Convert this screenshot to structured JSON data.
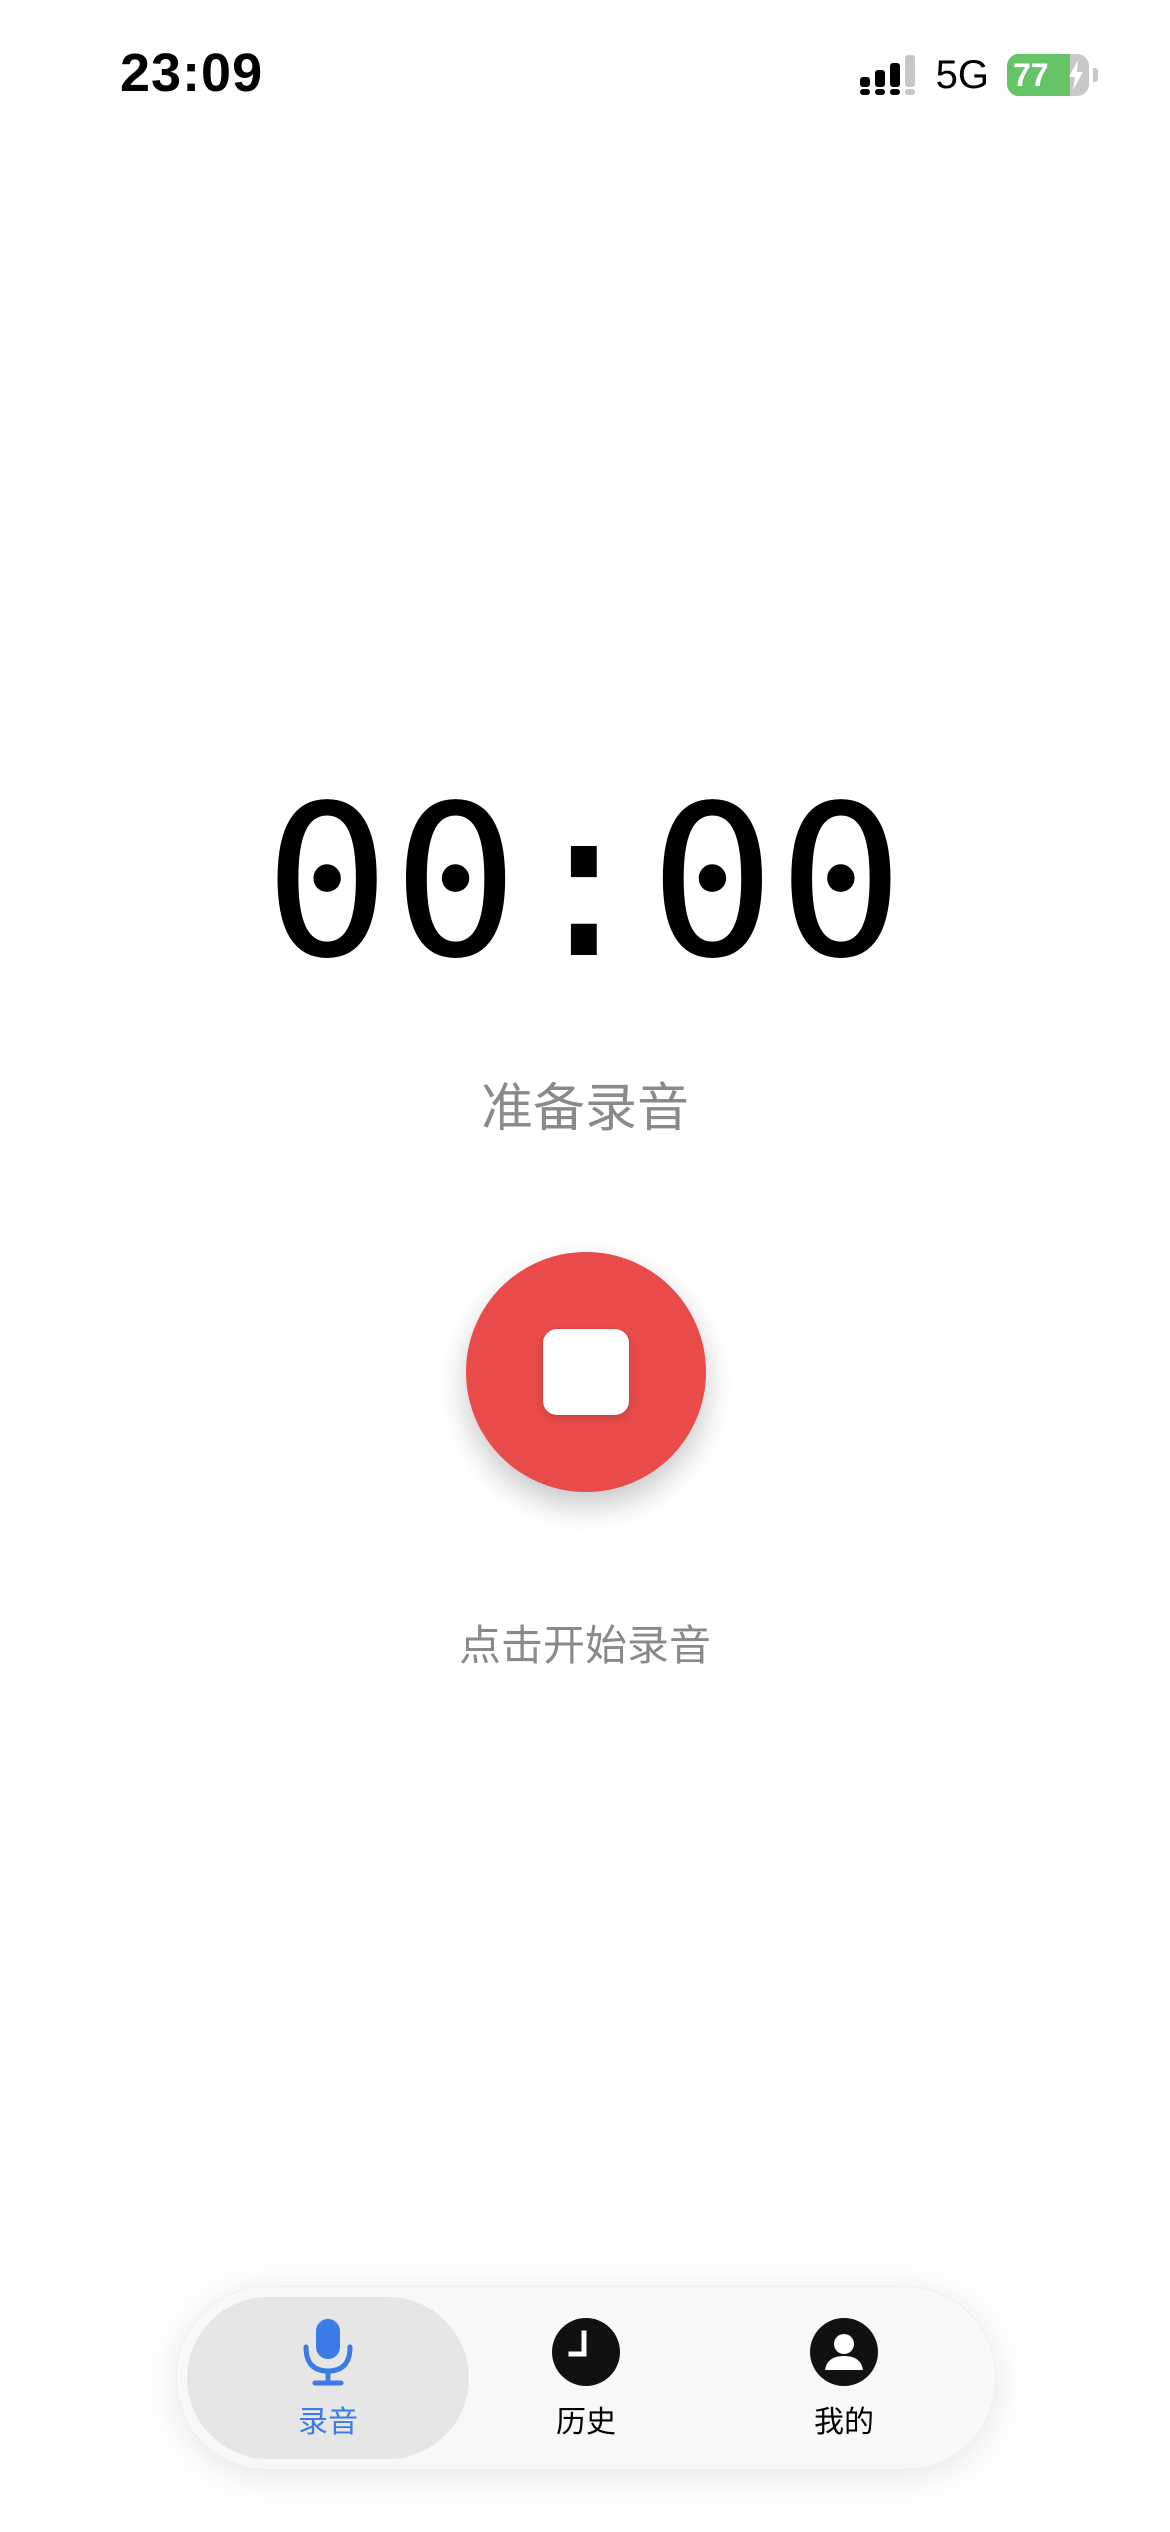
{
  "status_bar": {
    "time": "23:09",
    "network": "5G",
    "battery": "77",
    "battery_level": 0.77,
    "charging": true
  },
  "recorder": {
    "timer": "00:00",
    "status": "准备录音",
    "hint": "点击开始录音",
    "button_icon": "stop-icon"
  },
  "tab_bar": {
    "tabs": [
      {
        "label": "录音",
        "icon": "microphone-icon",
        "active": true
      },
      {
        "label": "历史",
        "icon": "clock-icon",
        "active": false
      },
      {
        "label": "我的",
        "icon": "person-icon",
        "active": false
      }
    ]
  },
  "colors": {
    "record_red": "#e84b49",
    "accent_blue": "#3b7be6",
    "battery_green": "#65c466",
    "secondary_text": "#8a8a8a"
  }
}
